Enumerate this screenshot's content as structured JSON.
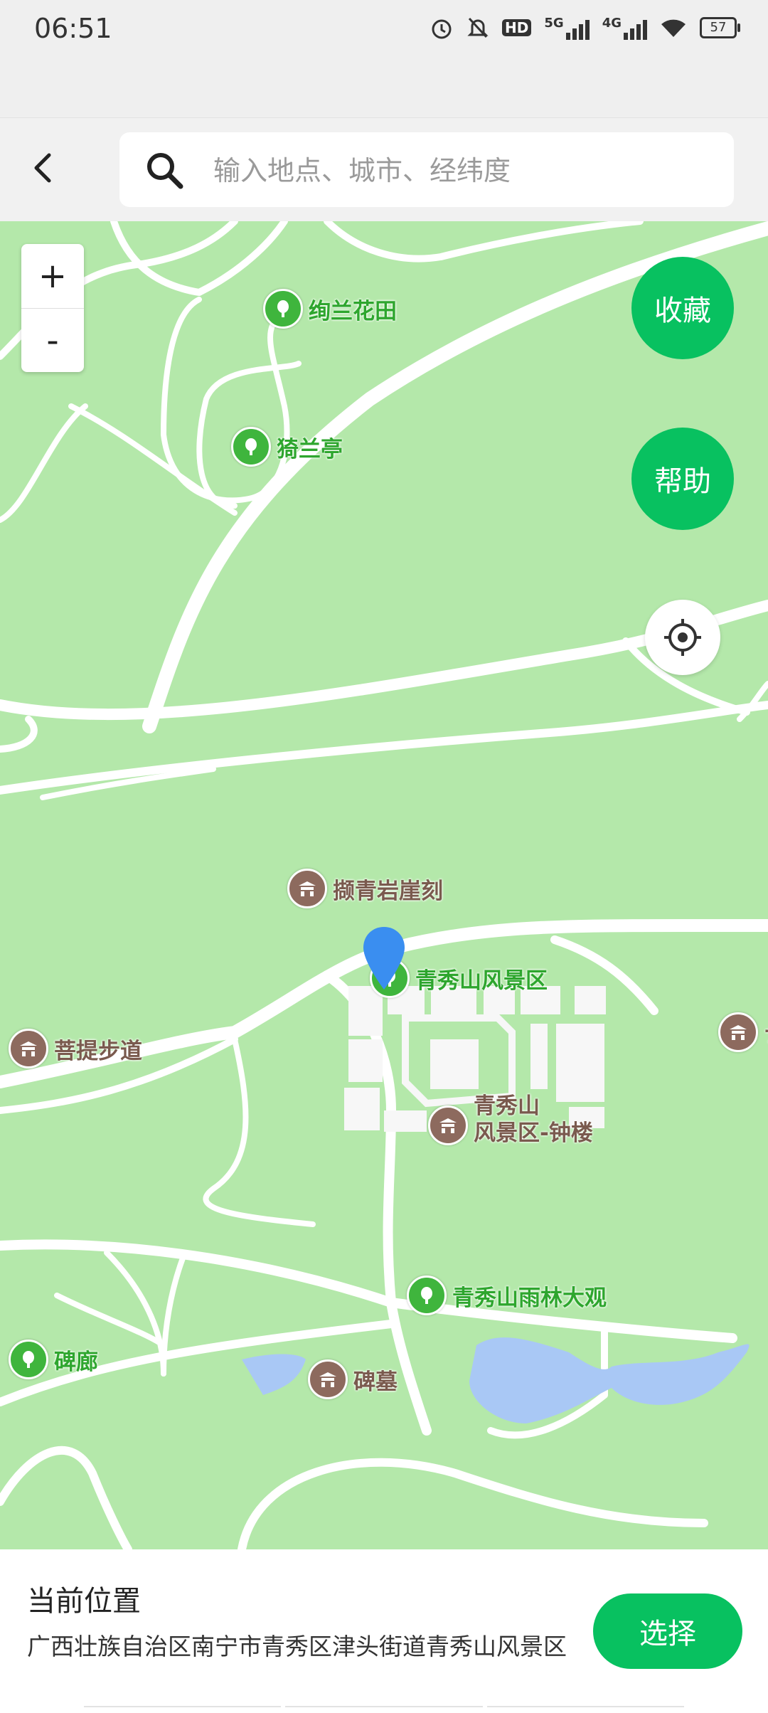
{
  "status_bar": {
    "time": "06:51",
    "battery": "57"
  },
  "search": {
    "placeholder": "输入地点、城市、经纬度",
    "value": ""
  },
  "map": {
    "zoom_in_label": "+",
    "zoom_out_label": "-",
    "favorite_label": "收藏",
    "help_label": "帮助",
    "pois": [
      {
        "name": "绚兰花田",
        "kind": "park"
      },
      {
        "name": "猗兰亭",
        "kind": "park"
      },
      {
        "name": "撷青岩崖刻",
        "kind": "historic"
      },
      {
        "name": "青秀山风景区",
        "kind": "park"
      },
      {
        "name": "菩提步道",
        "kind": "historic"
      },
      {
        "name": "青秀山\n风景区-钟楼",
        "kind": "historic"
      },
      {
        "name": "青秀山雨林大观",
        "kind": "park"
      },
      {
        "name": "碑廊",
        "kind": "park"
      },
      {
        "name": "碑墓",
        "kind": "historic"
      },
      {
        "name": "ナ",
        "kind": "historic"
      }
    ],
    "colors": {
      "land": "#b4e8aa",
      "road": "#ffffff",
      "water": "#a9c8f5",
      "accent": "#08c160",
      "pin": "#3a8ef0"
    }
  },
  "bottom": {
    "title": "当前位置",
    "address": "广西壮族自治区南宁市青秀区津头街道青秀山风景区",
    "select_label": "选择"
  }
}
